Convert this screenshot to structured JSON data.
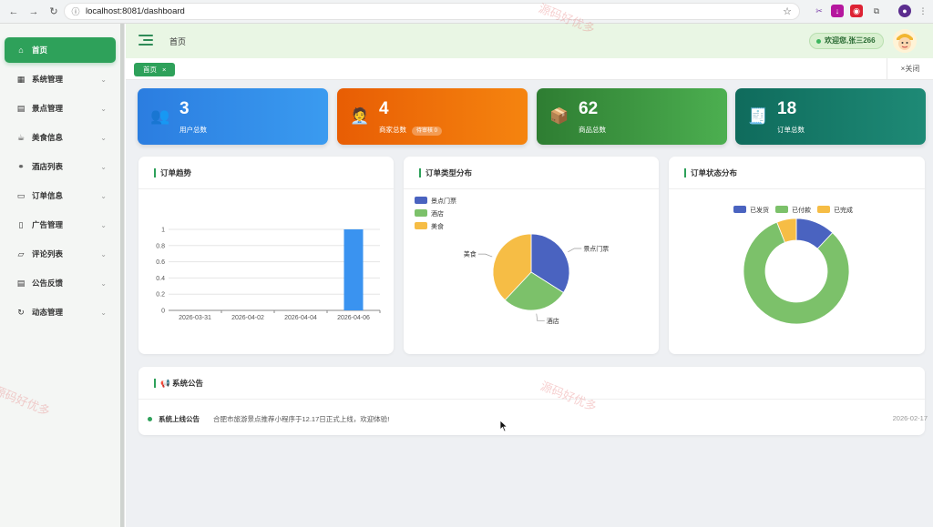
{
  "browser": {
    "url": "localhost:8081/dashboard"
  },
  "sidebar": {
    "items": [
      {
        "label": "首页",
        "icon": "home-icon",
        "glyph": "⌂"
      },
      {
        "label": "系统管理",
        "icon": "grid-icon",
        "glyph": "▦"
      },
      {
        "label": "景点管理",
        "icon": "building-icon",
        "glyph": "▤"
      },
      {
        "label": "美食信息",
        "icon": "food-icon",
        "glyph": "☕"
      },
      {
        "label": "酒店列表",
        "icon": "bike-icon",
        "glyph": "⚭"
      },
      {
        "label": "订单信息",
        "icon": "document-icon",
        "glyph": "▭"
      },
      {
        "label": "广告管理",
        "icon": "phone-icon",
        "glyph": "▯"
      },
      {
        "label": "评论列表",
        "icon": "comment-icon",
        "glyph": "▱"
      },
      {
        "label": "公告反馈",
        "icon": "notice-icon",
        "glyph": "▤"
      },
      {
        "label": "动态管理",
        "icon": "refresh-icon",
        "glyph": "↻"
      }
    ]
  },
  "header": {
    "breadcrumb": "首页",
    "welcome": "欢迎您,张三266"
  },
  "tabs": {
    "active": "首页",
    "close_glyph": "×",
    "close_all": "×关闭"
  },
  "stats": [
    {
      "value": "3",
      "label": "用户总数",
      "icon": "users-icon",
      "glyph": "👥",
      "color_from": "#2b7de0",
      "color_to": "#3a9bf0"
    },
    {
      "value": "4",
      "label": "商家总数",
      "badge": "待审核 0",
      "icon": "merchant-icon",
      "glyph": "🧑‍💼",
      "color_from": "#e85d04",
      "color_to": "#f5840f"
    },
    {
      "value": "62",
      "label": "商品总数",
      "icon": "package-icon",
      "glyph": "📦",
      "color_from": "#2e7d32",
      "color_to": "#4caf50"
    },
    {
      "value": "18",
      "label": "订单总数",
      "icon": "receipt-icon",
      "glyph": "🧾",
      "color_from": "#0f6b5c",
      "color_to": "#1e8a76"
    }
  ],
  "cards": {
    "trend_title": "订单趋势",
    "type_title": "订单类型分布",
    "status_title": "订单状态分布",
    "notice_title": "系统公告"
  },
  "notice": {
    "icon": "megaphone-icon",
    "title": "系统上线公告",
    "text": "合肥市旅游景点推荐小程序于12.17日正式上线，欢迎体验!",
    "date": "2026-02-17"
  },
  "watermarks": [
    "源码好优多",
    "源码好优多",
    "源码好优多"
  ],
  "chart_data": [
    {
      "type": "bar",
      "title": "订单趋势",
      "categories": [
        "2026-03-31",
        "2026-04-02",
        "2026-04-04",
        "2026-04-06"
      ],
      "values": [
        0,
        0,
        0,
        1
      ],
      "yticks": [
        "0",
        "0.2",
        "0.4",
        "0.6",
        "0.8",
        "1"
      ],
      "ylim": [
        0,
        1
      ],
      "color": "#3a93f0"
    },
    {
      "type": "pie",
      "title": "订单类型分布",
      "legend_position": "top-left",
      "slices": [
        {
          "name": "景点门票",
          "value": 34,
          "color": "#4a63c0"
        },
        {
          "name": "酒店",
          "value": 28,
          "color": "#7cc16a"
        },
        {
          "name": "美食",
          "value": 38,
          "color": "#f6bd45"
        }
      ]
    },
    {
      "type": "pie",
      "subtype": "donut",
      "title": "订单状态分布",
      "legend_position": "top",
      "slices": [
        {
          "name": "已发货",
          "value": 12,
          "color": "#4a63c0"
        },
        {
          "name": "已付款",
          "value": 82,
          "color": "#7cc16a"
        },
        {
          "name": "已完成",
          "value": 6,
          "color": "#f6bd45"
        }
      ]
    }
  ]
}
